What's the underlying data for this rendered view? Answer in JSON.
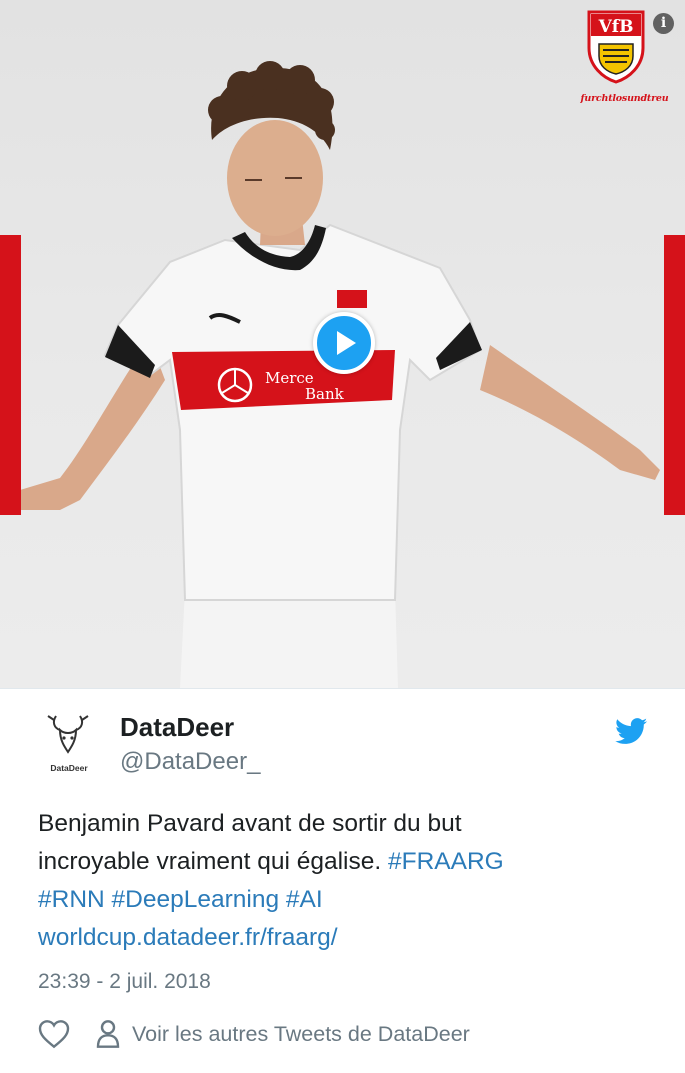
{
  "media": {
    "club_logo": "vfb-stuttgart-crest",
    "club_logo_text": "VfB",
    "tagline": "furchtlosundtreu",
    "info_icon": "info-icon",
    "info_glyph": "i",
    "play_icon": "play-icon",
    "colors": {
      "brand_red": "#d5121a",
      "play_blue": "#1da1f2"
    }
  },
  "tweet": {
    "author_name": "DataDeer",
    "author_handle": "@DataDeer_",
    "avatar_label": "DataDeer",
    "text_plain_1": "Benjamin Pavard avant de sortir du but",
    "text_plain_2": "incroyable vraiment qui égalise. ",
    "hashtags": [
      "#FRAARG",
      "#RNN",
      "#DeepLearning",
      "#AI"
    ],
    "link": "worldcup.datadeer.fr/fraarg/",
    "timestamp": "23:39 - 2 juil. 2018"
  },
  "actions": {
    "like_icon": "heart-icon",
    "profile_icon": "person-icon",
    "profile_link_label": "Voir les autres Tweets de DataDeer"
  },
  "colors": {
    "text": "#1c2022",
    "secondary": "#697882",
    "link": "#2b7bb9",
    "twitter_blue": "#1da1f2"
  }
}
